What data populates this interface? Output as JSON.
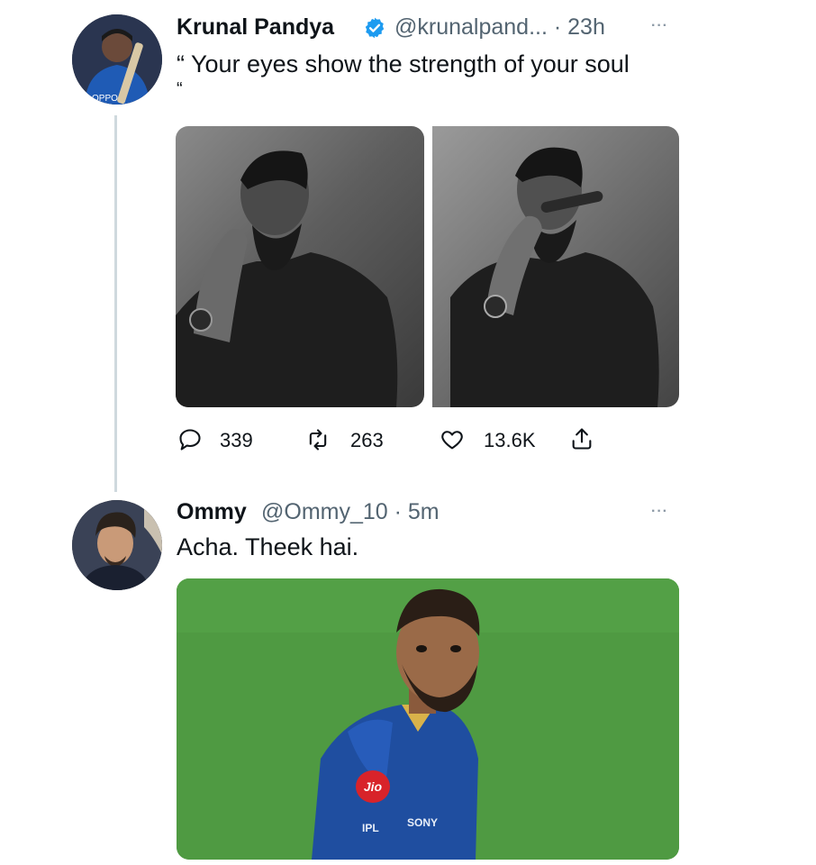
{
  "tweet": {
    "author_name": "Krunal Pandya",
    "handle_time": "@krunalpand... · 23h",
    "more_label": "···",
    "text": "“ Your eyes show the strength of your soul",
    "text_cont": "“",
    "stats": {
      "replies": "339",
      "retweets": "263",
      "likes": "13.6K"
    }
  },
  "reply": {
    "author_name": "Ommy",
    "handle_time": "@Ommy_10 · 5m",
    "more_label": "···",
    "text": "Acha. Theek hai."
  },
  "jersey": {
    "sponsor": "Jio",
    "badge_ipl": "IPL",
    "badge_sony": "SONY"
  },
  "colors": {
    "verified": "#1d9bf0",
    "muted": "#536471",
    "thread_line": "#cfd9de",
    "field_green": "#4f9a42",
    "jersey_blue": "#1f4ea0"
  },
  "icons": {
    "reply": "speech-bubble-icon",
    "retweet": "retweet-arrows-icon",
    "like": "heart-outline-icon",
    "share": "share-upload-icon",
    "verified": "verified-badge-icon"
  }
}
